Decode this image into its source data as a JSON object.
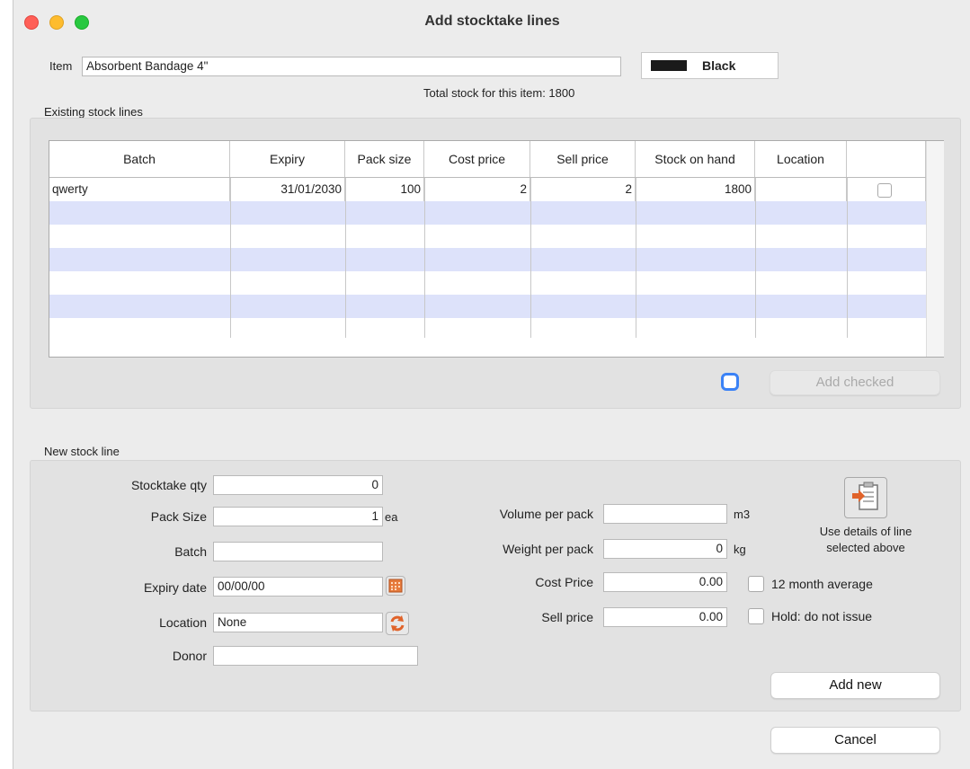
{
  "window": {
    "title": "Add stocktake lines"
  },
  "item": {
    "label": "Item",
    "value": "Absorbent Bandage 4\"",
    "color_name": "Black",
    "color_swatch": "#1a1a1a"
  },
  "total_stock": "Total stock for this item: 1800",
  "existing": {
    "section_label": "Existing stock lines",
    "columns": [
      "Batch",
      "Expiry",
      "Pack size",
      "Cost price",
      "Sell price",
      "Stock on hand",
      "Location",
      ""
    ],
    "rows": [
      {
        "batch": "qwerty",
        "expiry": "31/01/2030",
        "pack_size": "100",
        "cost_price": "2",
        "sell_price": "2",
        "stock_on_hand": "1800",
        "location": "",
        "checked": false
      }
    ],
    "add_checked_label": "Add checked"
  },
  "new_line": {
    "section_label": "New stock line",
    "stocktake_qty_label": "Stocktake qty",
    "stocktake_qty_value": "0",
    "pack_size_label": "Pack Size",
    "pack_size_value": "1",
    "pack_size_unit": "ea",
    "batch_label": "Batch",
    "batch_value": "",
    "expiry_label": "Expiry date",
    "expiry_value": "00/00/00",
    "location_label": "Location",
    "location_value": "None",
    "donor_label": "Donor",
    "donor_value": "",
    "volume_label": "Volume per pack",
    "volume_value": "",
    "volume_unit": "m3",
    "weight_label": "Weight per pack",
    "weight_value": "0",
    "weight_unit": "kg",
    "cost_label": "Cost Price",
    "cost_value": "0.00",
    "sell_label": "Sell price",
    "sell_value": "0.00",
    "avg_label": "12 month average",
    "hold_label": "Hold: do not issue",
    "use_details_line1": "Use details of line",
    "use_details_line2": "selected above",
    "add_new_label": "Add new"
  },
  "cancel_label": "Cancel"
}
